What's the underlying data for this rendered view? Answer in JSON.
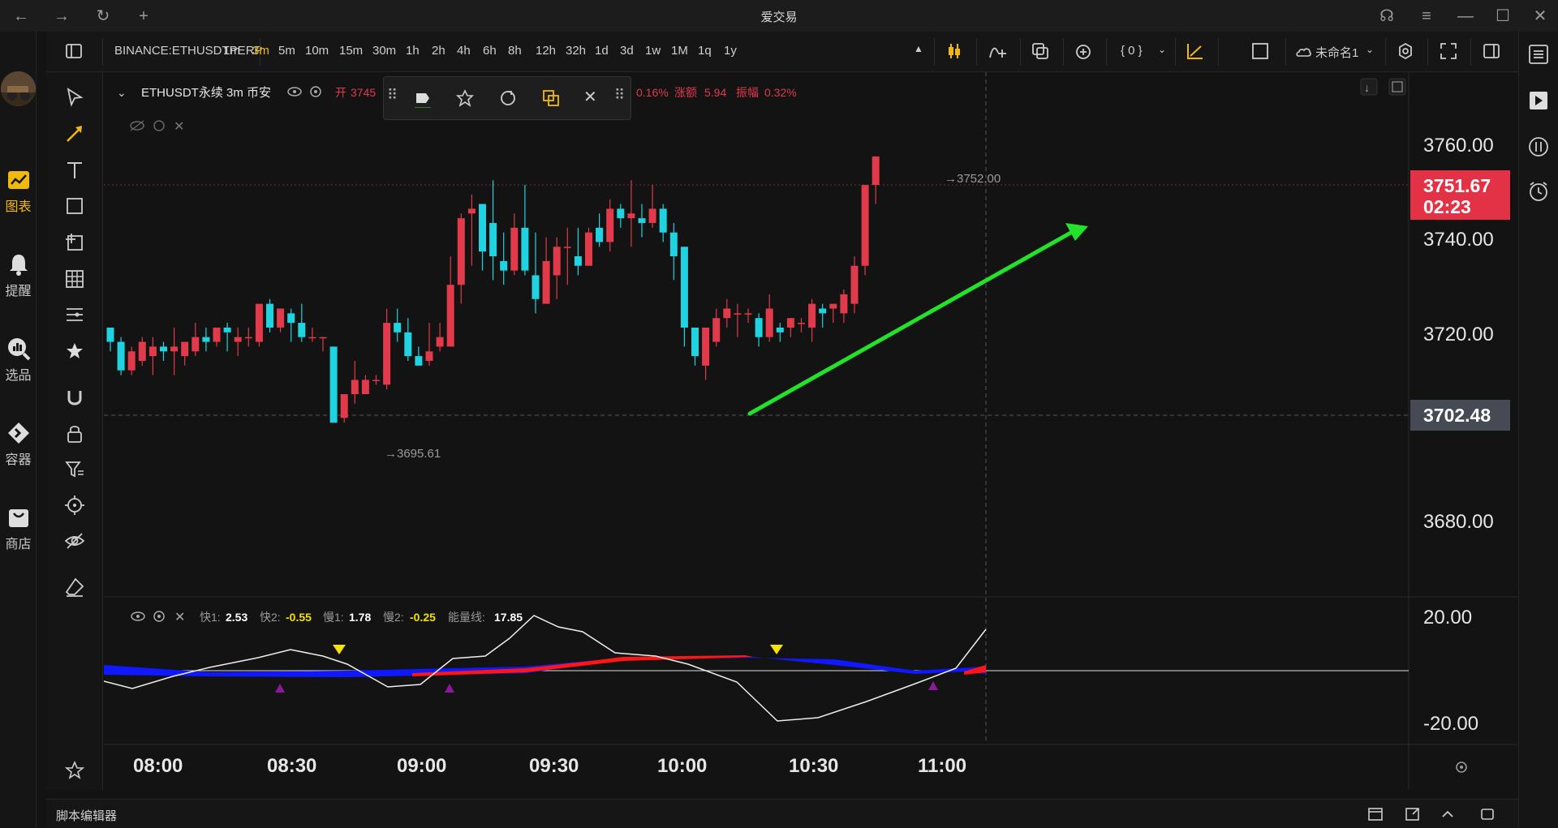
{
  "app": {
    "title": "爱交易"
  },
  "nav": {
    "items": [
      {
        "label": "图表",
        "active": true
      },
      {
        "label": "提醒"
      },
      {
        "label": "选品"
      },
      {
        "label": "容器"
      },
      {
        "label": "商店"
      }
    ]
  },
  "toolbar": {
    "symbol": "BINANCE:ETHUSDTPERP",
    "intervals": [
      "1m",
      "3m",
      "5m",
      "10m",
      "15m",
      "30m",
      "1h",
      "2h",
      "4h",
      "6h",
      "8h",
      "12h",
      "32h",
      "1d",
      "3d",
      "1w",
      "1M",
      "1q",
      "1y"
    ],
    "active_interval": "3m",
    "indicator_btn": "{ 0 }",
    "layout_name": "未命名1"
  },
  "legend": {
    "symbol_title": "ETHUSDT永续  3m  币安",
    "open_label": "开",
    "open_value": "3745",
    "change_text": "0.16%",
    "change_amount_label": "涨额",
    "change_amount": "5.94",
    "amplitude_label": "振幅",
    "amplitude": "0.32%"
  },
  "price_axis": {
    "ticks": [
      "3760.00",
      "3740.00",
      "3720.00",
      "3702.48",
      "3680.00"
    ],
    "last_price": "3751.67",
    "countdown": "02:23",
    "crosshair_price": "3702.48"
  },
  "annotations": {
    "high": "→3752.00",
    "low": "→3695.61"
  },
  "time_axis": {
    "ticks": [
      "08:00",
      "08:30",
      "09:00",
      "09:30",
      "10:00",
      "10:30",
      "11:00"
    ]
  },
  "indicator": {
    "fast1_label": "快1:",
    "fast1": "2.53",
    "fast2_label": "快2:",
    "fast2": "-0.55",
    "slow1_label": "慢1:",
    "slow1": "1.78",
    "slow2_label": "慢2:",
    "slow2": "-0.25",
    "energy_label": "能量线:",
    "energy": "17.85",
    "ticks": [
      "20.00",
      "-20.00"
    ]
  },
  "statusbar": {
    "script_editor": "脚本编辑器"
  },
  "colors": {
    "up": "#e03a4b",
    "down": "#1fd4e0",
    "accent": "#f0b90b",
    "arrow": "#22e22a",
    "price_tag": "#e33245",
    "cross_tag": "#454a54"
  },
  "chart_data": {
    "type": "candlestick",
    "y_range": [
      3670,
      3770
    ],
    "candles": [
      [
        3716,
        3713,
        3716,
        3711
      ],
      [
        3713,
        3707,
        3714,
        3706
      ],
      [
        3707,
        3711,
        3712,
        3706
      ],
      [
        3709,
        3713,
        3714,
        3708
      ],
      [
        3710,
        3712,
        3714,
        3706
      ],
      [
        3712,
        3711,
        3713,
        3709
      ],
      [
        3711,
        3712,
        3716,
        3706
      ],
      [
        3710,
        3713,
        3713,
        3708
      ],
      [
        3711,
        3714,
        3717,
        3710
      ],
      [
        3714,
        3713,
        3716,
        3711
      ],
      [
        3713,
        3716,
        3716,
        3712
      ],
      [
        3716,
        3715,
        3717,
        3711
      ],
      [
        3713,
        3714,
        3716,
        3710
      ],
      [
        3714,
        3714,
        3716,
        3712
      ],
      [
        3713,
        3721,
        3721,
        3712
      ],
      [
        3721,
        3716,
        3722,
        3715
      ],
      [
        3716,
        3720,
        3720,
        3715
      ],
      [
        3719,
        3717,
        3720,
        3713
      ],
      [
        3717,
        3714,
        3721,
        3713
      ],
      [
        3714,
        3714,
        3716,
        3713
      ],
      [
        3714,
        3714,
        3714,
        3711
      ],
      [
        3712,
        3696,
        3712,
        3696
      ],
      [
        3697,
        3702,
        3702,
        3696
      ],
      [
        3702,
        3705,
        3709,
        3700
      ],
      [
        3702,
        3705,
        3706,
        3704
      ],
      [
        3705,
        3705,
        3706,
        3704
      ],
      [
        3704,
        3717,
        3720,
        3703
      ],
      [
        3717,
        3715,
        3720,
        3713
      ],
      [
        3715,
        3710,
        3718,
        3709
      ],
      [
        3710,
        3708,
        3712,
        3708
      ],
      [
        3709,
        3711,
        3717,
        3708
      ],
      [
        3712,
        3714,
        3717,
        3711
      ],
      [
        3712,
        3725,
        3731,
        3713
      ],
      [
        3725,
        3739,
        3740,
        3721
      ],
      [
        3740,
        3741,
        3744,
        3729
      ],
      [
        3742,
        3732,
        3742,
        3728
      ],
      [
        3738,
        3731,
        3747,
        3726
      ],
      [
        3730,
        3728,
        3736,
        3725
      ],
      [
        3728,
        3737,
        3740,
        3727
      ],
      [
        3737,
        3728,
        3746,
        3727
      ],
      [
        3727,
        3722,
        3736,
        3719
      ],
      [
        3721,
        3730,
        3735,
        3727
      ],
      [
        3727,
        3733,
        3735,
        3722
      ],
      [
        3733,
        3733,
        3737,
        3725
      ],
      [
        3731,
        3729,
        3737,
        3727
      ],
      [
        3729,
        3736,
        3737,
        3729
      ],
      [
        3737,
        3734,
        3740,
        3733
      ],
      [
        3734,
        3741,
        3743,
        3732
      ],
      [
        3741,
        3739,
        3742,
        3737
      ],
      [
        3739,
        3740,
        3747,
        3733
      ],
      [
        3739,
        3738,
        3742,
        3735
      ],
      [
        3738,
        3741,
        3746,
        3737
      ],
      [
        3741,
        3736,
        3742,
        3734
      ],
      [
        3736,
        3731,
        3738,
        3726
      ],
      [
        3733,
        3716,
        3733,
        3712
      ],
      [
        3716,
        3710,
        3716,
        3708
      ],
      [
        3708,
        3716,
        3716,
        3705
      ],
      [
        3713,
        3718,
        3720,
        3712
      ],
      [
        3718,
        3720,
        3722,
        3716
      ],
      [
        3719,
        3719,
        3721,
        3714
      ],
      [
        3719,
        3719,
        3720,
        3717
      ],
      [
        3718,
        3714,
        3719,
        3712
      ],
      [
        3714,
        3720,
        3723,
        3713
      ],
      [
        3716,
        3715,
        3717,
        3713
      ],
      [
        3716,
        3718,
        3718,
        3714
      ],
      [
        3717,
        3717,
        3718,
        3715
      ],
      [
        3716,
        3721,
        3722,
        3713
      ],
      [
        3720,
        3719,
        3721,
        3716
      ],
      [
        3720,
        3721,
        3721,
        3717
      ],
      [
        3719,
        3723,
        3724,
        3717
      ],
      [
        3721,
        3729,
        3731,
        3719
      ],
      [
        3729,
        3746,
        3746,
        3727
      ],
      [
        3746,
        3752,
        3752,
        3742
      ]
    ]
  }
}
